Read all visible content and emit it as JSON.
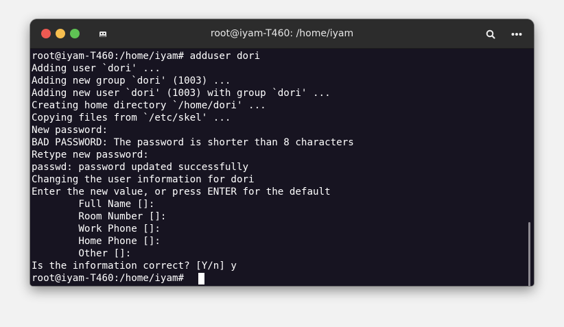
{
  "window": {
    "title": "root@iyam-T460: /home/iyam"
  },
  "icons": {
    "tab": "new-tab-icon",
    "search": "search-icon",
    "menu": "more-options-icon"
  },
  "colors": {
    "terminal_bg": "#171421",
    "titlebar_bg": "#2c2c2c",
    "close": "#ee5a52",
    "minimize": "#f6be4f",
    "maximize": "#5fc254",
    "text": "#ffffff"
  },
  "terminal": {
    "lines": [
      "root@iyam-T460:/home/iyam# adduser dori",
      "Adding user `dori' ...",
      "Adding new group `dori' (1003) ...",
      "Adding new user `dori' (1003) with group `dori' ...",
      "Creating home directory `/home/dori' ...",
      "Copying files from `/etc/skel' ...",
      "New password:",
      "BAD PASSWORD: The password is shorter than 8 characters",
      "Retype new password:",
      "passwd: password updated successfully",
      "Changing the user information for dori",
      "Enter the new value, or press ENTER for the default",
      "        Full Name []:",
      "        Room Number []:",
      "        Work Phone []:",
      "        Home Phone []:",
      "        Other []:",
      "Is the information correct? [Y/n] y",
      "root@iyam-T460:/home/iyam# "
    ]
  }
}
